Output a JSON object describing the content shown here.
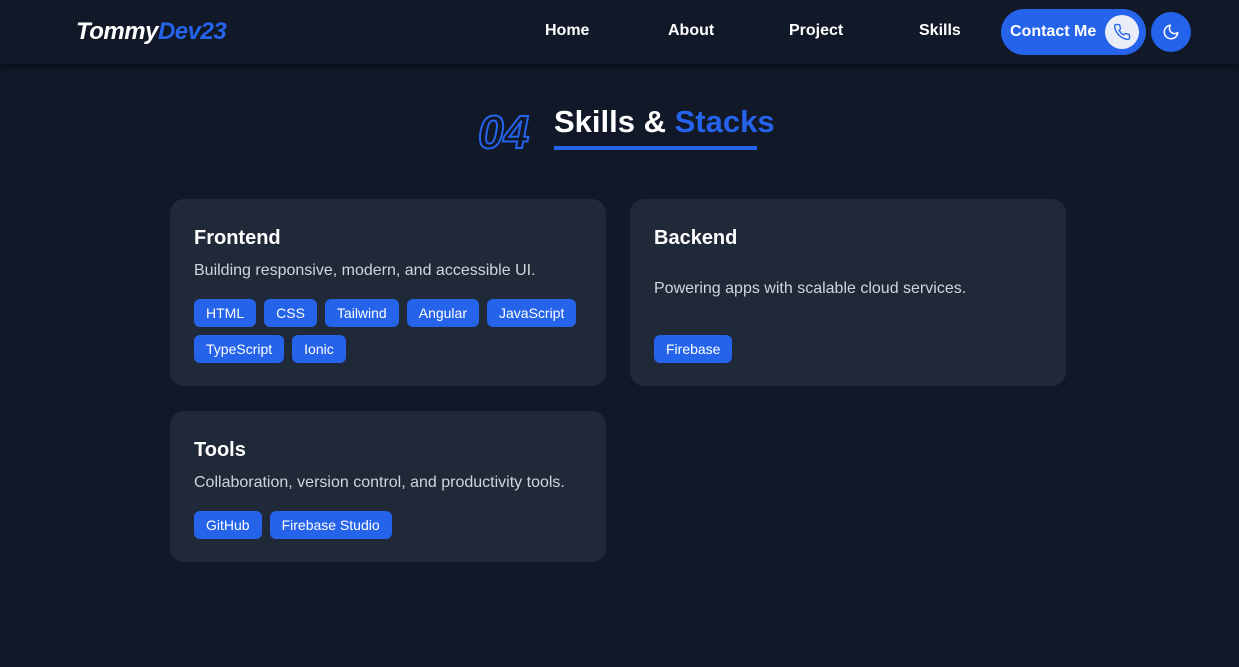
{
  "brand": {
    "name_part1": "Tommy",
    "name_part2": "Dev23",
    "accent_color": "#2563eb",
    "background_color": "#111827",
    "card_color": "#1f2937"
  },
  "nav": {
    "links": [
      {
        "label": "Home"
      },
      {
        "label": "About"
      },
      {
        "label": "Project"
      },
      {
        "label": "Skills"
      }
    ],
    "contact_label": "Contact Me",
    "contact_icon": "phone-icon",
    "theme_icon": "moon-icon"
  },
  "section": {
    "number": "04",
    "title_part1": "Skills & ",
    "title_part2": "Stacks"
  },
  "cards": [
    {
      "title": "Frontend",
      "description": "Building responsive, modern, and accessible UI.",
      "tags": [
        "HTML",
        "CSS",
        "Tailwind",
        "Angular",
        "JavaScript",
        "TypeScript",
        "Ionic"
      ]
    },
    {
      "title": "Backend",
      "description": "Powering apps with scalable cloud services.",
      "tags": [
        "Firebase"
      ]
    },
    {
      "title": "Tools",
      "description": "Collaboration, version control, and productivity tools.",
      "tags": [
        "GitHub",
        "Firebase Studio"
      ]
    }
  ]
}
